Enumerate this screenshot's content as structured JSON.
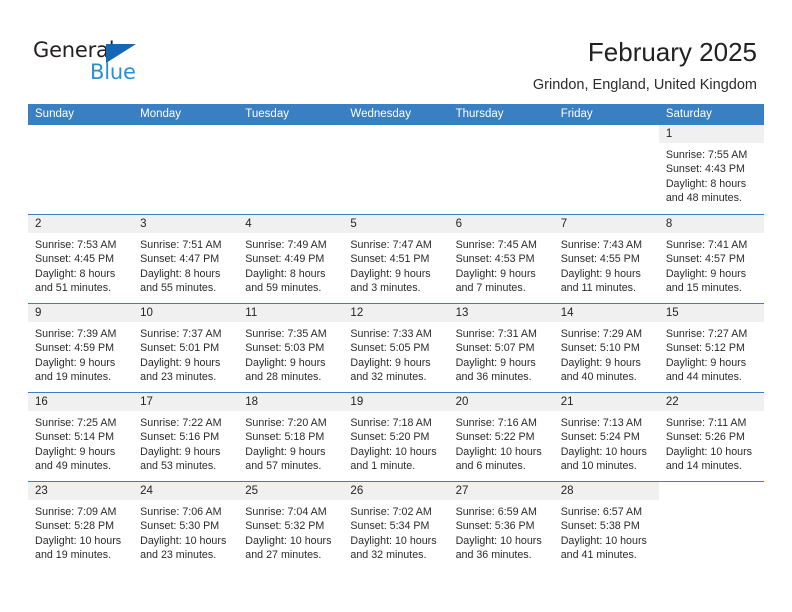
{
  "brand": {
    "name_part1": "General",
    "name_part2": "Blue",
    "triangle_icon": "brand-triangle-icon",
    "colors": {
      "dark": "#231f20",
      "blue": "#2a8fd4",
      "triangle": "#1567b5",
      "header_band": "#3a7fc1",
      "day_head": "#f0f0f0"
    }
  },
  "header": {
    "title": "February 2025",
    "subtitle": "Grindon, England, United Kingdom"
  },
  "calendar": {
    "weekdays": [
      "Sunday",
      "Monday",
      "Tuesday",
      "Wednesday",
      "Thursday",
      "Friday",
      "Saturday"
    ],
    "weeks": [
      [
        {
          "day": "",
          "empty": true
        },
        {
          "day": "",
          "empty": true
        },
        {
          "day": "",
          "empty": true
        },
        {
          "day": "",
          "empty": true
        },
        {
          "day": "",
          "empty": true
        },
        {
          "day": "",
          "empty": true
        },
        {
          "day": "1",
          "sunrise": "Sunrise: 7:55 AM",
          "sunset": "Sunset: 4:43 PM",
          "daylight1": "Daylight: 8 hours",
          "daylight2": "and 48 minutes."
        }
      ],
      [
        {
          "day": "2",
          "sunrise": "Sunrise: 7:53 AM",
          "sunset": "Sunset: 4:45 PM",
          "daylight1": "Daylight: 8 hours",
          "daylight2": "and 51 minutes."
        },
        {
          "day": "3",
          "sunrise": "Sunrise: 7:51 AM",
          "sunset": "Sunset: 4:47 PM",
          "daylight1": "Daylight: 8 hours",
          "daylight2": "and 55 minutes."
        },
        {
          "day": "4",
          "sunrise": "Sunrise: 7:49 AM",
          "sunset": "Sunset: 4:49 PM",
          "daylight1": "Daylight: 8 hours",
          "daylight2": "and 59 minutes."
        },
        {
          "day": "5",
          "sunrise": "Sunrise: 7:47 AM",
          "sunset": "Sunset: 4:51 PM",
          "daylight1": "Daylight: 9 hours",
          "daylight2": "and 3 minutes."
        },
        {
          "day": "6",
          "sunrise": "Sunrise: 7:45 AM",
          "sunset": "Sunset: 4:53 PM",
          "daylight1": "Daylight: 9 hours",
          "daylight2": "and 7 minutes."
        },
        {
          "day": "7",
          "sunrise": "Sunrise: 7:43 AM",
          "sunset": "Sunset: 4:55 PM",
          "daylight1": "Daylight: 9 hours",
          "daylight2": "and 11 minutes."
        },
        {
          "day": "8",
          "sunrise": "Sunrise: 7:41 AM",
          "sunset": "Sunset: 4:57 PM",
          "daylight1": "Daylight: 9 hours",
          "daylight2": "and 15 minutes."
        }
      ],
      [
        {
          "day": "9",
          "sunrise": "Sunrise: 7:39 AM",
          "sunset": "Sunset: 4:59 PM",
          "daylight1": "Daylight: 9 hours",
          "daylight2": "and 19 minutes."
        },
        {
          "day": "10",
          "sunrise": "Sunrise: 7:37 AM",
          "sunset": "Sunset: 5:01 PM",
          "daylight1": "Daylight: 9 hours",
          "daylight2": "and 23 minutes."
        },
        {
          "day": "11",
          "sunrise": "Sunrise: 7:35 AM",
          "sunset": "Sunset: 5:03 PM",
          "daylight1": "Daylight: 9 hours",
          "daylight2": "and 28 minutes."
        },
        {
          "day": "12",
          "sunrise": "Sunrise: 7:33 AM",
          "sunset": "Sunset: 5:05 PM",
          "daylight1": "Daylight: 9 hours",
          "daylight2": "and 32 minutes."
        },
        {
          "day": "13",
          "sunrise": "Sunrise: 7:31 AM",
          "sunset": "Sunset: 5:07 PM",
          "daylight1": "Daylight: 9 hours",
          "daylight2": "and 36 minutes."
        },
        {
          "day": "14",
          "sunrise": "Sunrise: 7:29 AM",
          "sunset": "Sunset: 5:10 PM",
          "daylight1": "Daylight: 9 hours",
          "daylight2": "and 40 minutes."
        },
        {
          "day": "15",
          "sunrise": "Sunrise: 7:27 AM",
          "sunset": "Sunset: 5:12 PM",
          "daylight1": "Daylight: 9 hours",
          "daylight2": "and 44 minutes."
        }
      ],
      [
        {
          "day": "16",
          "sunrise": "Sunrise: 7:25 AM",
          "sunset": "Sunset: 5:14 PM",
          "daylight1": "Daylight: 9 hours",
          "daylight2": "and 49 minutes."
        },
        {
          "day": "17",
          "sunrise": "Sunrise: 7:22 AM",
          "sunset": "Sunset: 5:16 PM",
          "daylight1": "Daylight: 9 hours",
          "daylight2": "and 53 minutes."
        },
        {
          "day": "18",
          "sunrise": "Sunrise: 7:20 AM",
          "sunset": "Sunset: 5:18 PM",
          "daylight1": "Daylight: 9 hours",
          "daylight2": "and 57 minutes."
        },
        {
          "day": "19",
          "sunrise": "Sunrise: 7:18 AM",
          "sunset": "Sunset: 5:20 PM",
          "daylight1": "Daylight: 10 hours",
          "daylight2": "and 1 minute."
        },
        {
          "day": "20",
          "sunrise": "Sunrise: 7:16 AM",
          "sunset": "Sunset: 5:22 PM",
          "daylight1": "Daylight: 10 hours",
          "daylight2": "and 6 minutes."
        },
        {
          "day": "21",
          "sunrise": "Sunrise: 7:13 AM",
          "sunset": "Sunset: 5:24 PM",
          "daylight1": "Daylight: 10 hours",
          "daylight2": "and 10 minutes."
        },
        {
          "day": "22",
          "sunrise": "Sunrise: 7:11 AM",
          "sunset": "Sunset: 5:26 PM",
          "daylight1": "Daylight: 10 hours",
          "daylight2": "and 14 minutes."
        }
      ],
      [
        {
          "day": "23",
          "sunrise": "Sunrise: 7:09 AM",
          "sunset": "Sunset: 5:28 PM",
          "daylight1": "Daylight: 10 hours",
          "daylight2": "and 19 minutes."
        },
        {
          "day": "24",
          "sunrise": "Sunrise: 7:06 AM",
          "sunset": "Sunset: 5:30 PM",
          "daylight1": "Daylight: 10 hours",
          "daylight2": "and 23 minutes."
        },
        {
          "day": "25",
          "sunrise": "Sunrise: 7:04 AM",
          "sunset": "Sunset: 5:32 PM",
          "daylight1": "Daylight: 10 hours",
          "daylight2": "and 27 minutes."
        },
        {
          "day": "26",
          "sunrise": "Sunrise: 7:02 AM",
          "sunset": "Sunset: 5:34 PM",
          "daylight1": "Daylight: 10 hours",
          "daylight2": "and 32 minutes."
        },
        {
          "day": "27",
          "sunrise": "Sunrise: 6:59 AM",
          "sunset": "Sunset: 5:36 PM",
          "daylight1": "Daylight: 10 hours",
          "daylight2": "and 36 minutes."
        },
        {
          "day": "28",
          "sunrise": "Sunrise: 6:57 AM",
          "sunset": "Sunset: 5:38 PM",
          "daylight1": "Daylight: 10 hours",
          "daylight2": "and 41 minutes."
        },
        {
          "day": "",
          "empty": true
        }
      ]
    ]
  }
}
